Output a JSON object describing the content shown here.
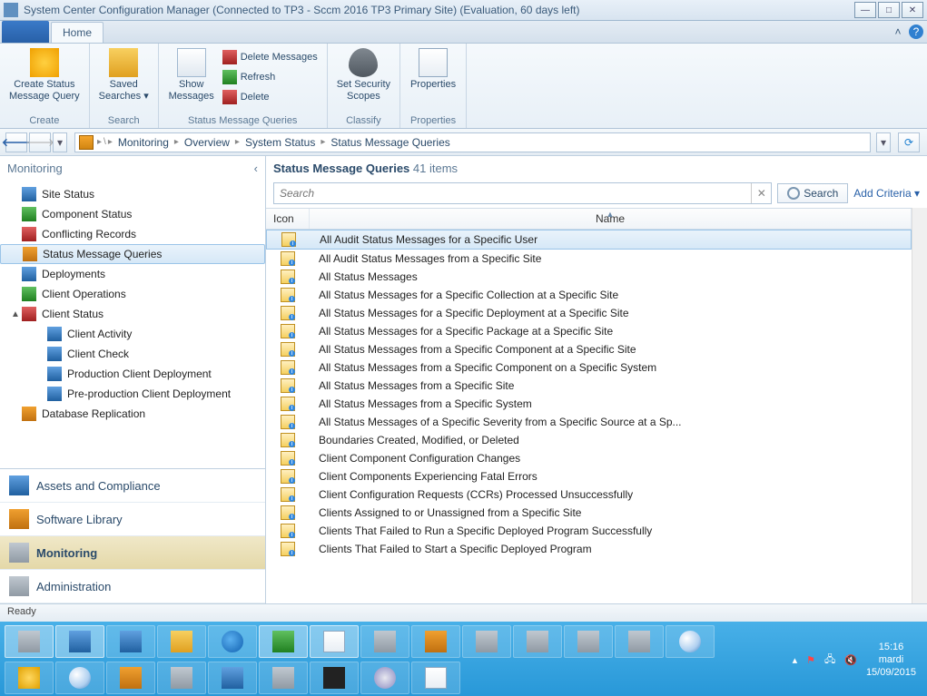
{
  "title": "System Center Configuration Manager (Connected to TP3 - Sccm 2016 TP3 Primary Site) (Evaluation, 60 days left)",
  "ribbon": {
    "tab_home": "Home",
    "groups": {
      "create": {
        "label": "Create",
        "btn": "Create Status\nMessage Query"
      },
      "search": {
        "label": "Search",
        "btn": "Saved\nSearches"
      },
      "smq": {
        "label": "Status Message Queries",
        "show": "Show\nMessages",
        "delete": "Delete Messages",
        "refresh": "Refresh",
        "del": "Delete"
      },
      "classify": {
        "label": "Classify",
        "btn": "Set Security\nScopes"
      },
      "properties": {
        "label": "Properties",
        "btn": "Properties"
      }
    }
  },
  "breadcrumb": [
    "Monitoring",
    "Overview",
    "System Status",
    "Status Message Queries"
  ],
  "nav": {
    "header": "Monitoring",
    "tree": [
      {
        "label": "Site Status",
        "lvl": 1
      },
      {
        "label": "Component Status",
        "lvl": 1
      },
      {
        "label": "Conflicting Records",
        "lvl": 1
      },
      {
        "label": "Status Message Queries",
        "lvl": 1,
        "selected": true
      },
      {
        "label": "Deployments",
        "lvl": 1
      },
      {
        "label": "Client Operations",
        "lvl": 1
      },
      {
        "label": "Client Status",
        "lvl": 1,
        "arrow": "▲"
      },
      {
        "label": "Client Activity",
        "lvl": 2
      },
      {
        "label": "Client Check",
        "lvl": 2
      },
      {
        "label": "Production Client Deployment",
        "lvl": 2
      },
      {
        "label": "Pre-production Client Deployment",
        "lvl": 2
      },
      {
        "label": "Database Replication",
        "lvl": 1
      }
    ],
    "sections": [
      {
        "label": "Assets and Compliance"
      },
      {
        "label": "Software Library"
      },
      {
        "label": "Monitoring",
        "active": true
      },
      {
        "label": "Administration"
      }
    ]
  },
  "content": {
    "title": "Status Message Queries",
    "count": "41 items",
    "search_placeholder": "Search",
    "search_btn": "Search",
    "add_criteria": "Add Criteria",
    "cols": {
      "icon": "Icon",
      "name": "Name"
    },
    "rows": [
      {
        "name": "All Audit Status Messages for a Specific User",
        "selected": true
      },
      {
        "name": "All Audit Status Messages from a Specific Site"
      },
      {
        "name": "All Status Messages"
      },
      {
        "name": "All Status Messages for a Specific Collection at a Specific Site"
      },
      {
        "name": "All Status Messages for a Specific Deployment at a Specific Site"
      },
      {
        "name": "All Status Messages for a Specific Package at a Specific Site"
      },
      {
        "name": "All Status Messages from a Specific Component at a Specific Site"
      },
      {
        "name": "All Status Messages from a Specific Component on a Specific System"
      },
      {
        "name": "All Status Messages from a Specific Site"
      },
      {
        "name": "All Status Messages from a Specific System"
      },
      {
        "name": "All Status Messages of a Specific Severity from a Specific Source at a Sp..."
      },
      {
        "name": "Boundaries Created, Modified, or Deleted"
      },
      {
        "name": "Client Component Configuration Changes"
      },
      {
        "name": "Client Components Experiencing Fatal Errors"
      },
      {
        "name": "Client Configuration Requests (CCRs) Processed Unsuccessfully"
      },
      {
        "name": "Clients Assigned to or Unassigned from a Specific Site"
      },
      {
        "name": "Clients That Failed to Run a Specific Deployed Program Successfully"
      },
      {
        "name": "Clients That Failed to Start a Specific Deployed Program"
      }
    ]
  },
  "status": "Ready",
  "tray": {
    "time": "15:16",
    "day": "mardi",
    "date": "15/09/2015"
  }
}
